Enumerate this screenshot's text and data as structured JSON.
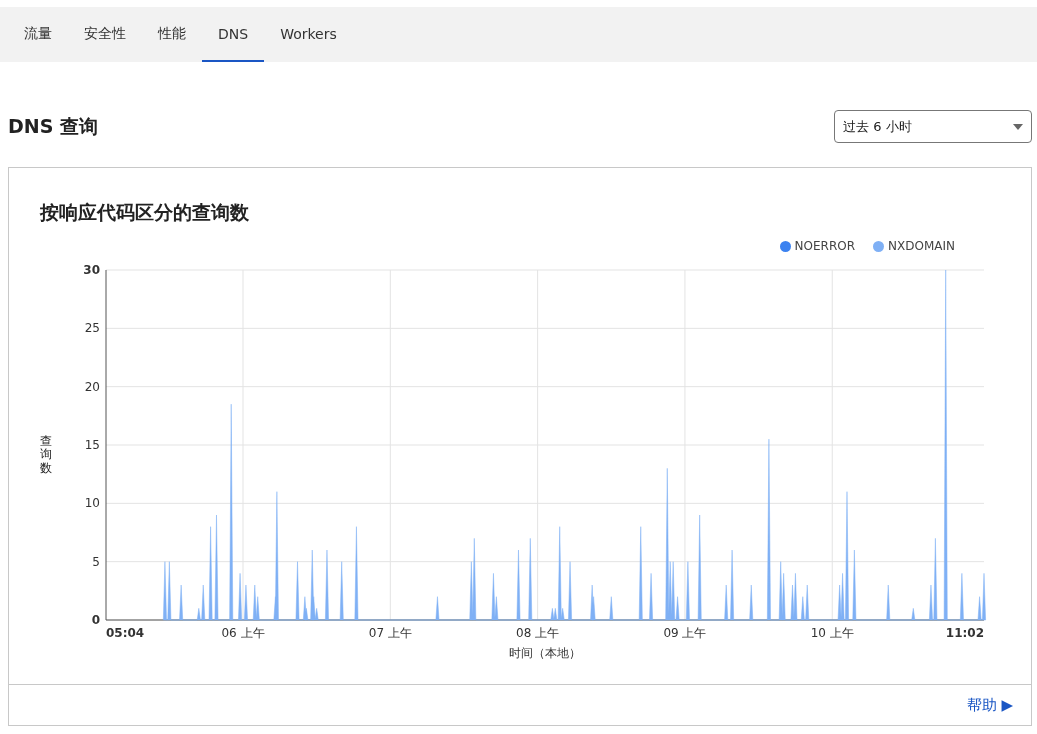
{
  "tabs": [
    {
      "label": "流量",
      "selected": false
    },
    {
      "label": "安全性",
      "selected": false
    },
    {
      "label": "性能",
      "selected": false
    },
    {
      "label": "DNS",
      "selected": true
    },
    {
      "label": "Workers",
      "selected": false
    }
  ],
  "section": {
    "title": "DNS 查询",
    "range_select": {
      "value": "过去 6 小时"
    }
  },
  "card": {
    "title": "按响应代码区分的查询数",
    "legend": [
      {
        "name": "NOERROR",
        "color": "#3b82f0"
      }
    ],
    "chart_data": {
      "type": "area",
      "xlabel": "时间（本地）",
      "ylabel": "查询数",
      "grid": true,
      "xlim": [
        5.07,
        11.03
      ],
      "ylim": [
        0,
        30
      ],
      "xticks": [
        {
          "value": 5.07,
          "label": "05:04"
        },
        {
          "value": 6,
          "label": "06 上午"
        },
        {
          "value": 7,
          "label": "07 上午"
        },
        {
          "value": 8,
          "label": "08 上午"
        },
        {
          "value": 9,
          "label": "09 上午"
        },
        {
          "value": 10,
          "label": "10 上午"
        },
        {
          "value": 11.03,
          "label": "11:02"
        }
      ],
      "yticks": [
        0,
        5,
        10,
        15,
        20,
        25,
        30
      ],
      "x": [
        5.47,
        5.5,
        5.58,
        5.7,
        5.73,
        5.78,
        5.82,
        5.92,
        5.98,
        6.02,
        6.08,
        6.1,
        6.22,
        6.23,
        6.37,
        6.42,
        6.43,
        6.47,
        6.48,
        6.5,
        6.57,
        6.67,
        6.77,
        7.32,
        7.55,
        7.57,
        7.7,
        7.72,
        7.87,
        7.95,
        8.1,
        8.12,
        8.15,
        8.17,
        8.22,
        8.37,
        8.38,
        8.5,
        8.7,
        8.77,
        8.88,
        8.9,
        8.92,
        8.95,
        9.02,
        9.1,
        9.28,
        9.32,
        9.45,
        9.57,
        9.65,
        9.67,
        9.73,
        9.75,
        9.8,
        9.83,
        10.05,
        10.07,
        10.1,
        10.15,
        10.38,
        10.55,
        10.67,
        10.7,
        10.77,
        10.88,
        11,
        11.03
      ],
      "series": [
        {
          "name": "NXDOMAIN",
          "color": "#7fb0f5",
          "values": [
            5,
            5,
            3,
            1,
            3,
            8,
            9,
            18.5,
            4,
            3,
            3,
            2,
            2,
            11,
            5,
            2,
            1,
            6,
            2,
            1,
            6,
            5,
            8,
            2,
            5,
            7,
            4,
            2,
            6,
            7,
            1,
            1,
            8,
            1,
            5,
            3,
            2,
            2,
            8,
            4,
            13,
            5,
            5,
            2,
            5,
            9,
            3,
            6,
            3,
            15.5,
            5,
            4,
            3,
            4,
            2,
            3,
            3,
            4,
            11,
            6,
            3,
            1,
            3,
            7,
            30,
            4,
            2,
            4
          ]
        }
      ]
    }
  },
  "help_link": "帮助 ▶"
}
